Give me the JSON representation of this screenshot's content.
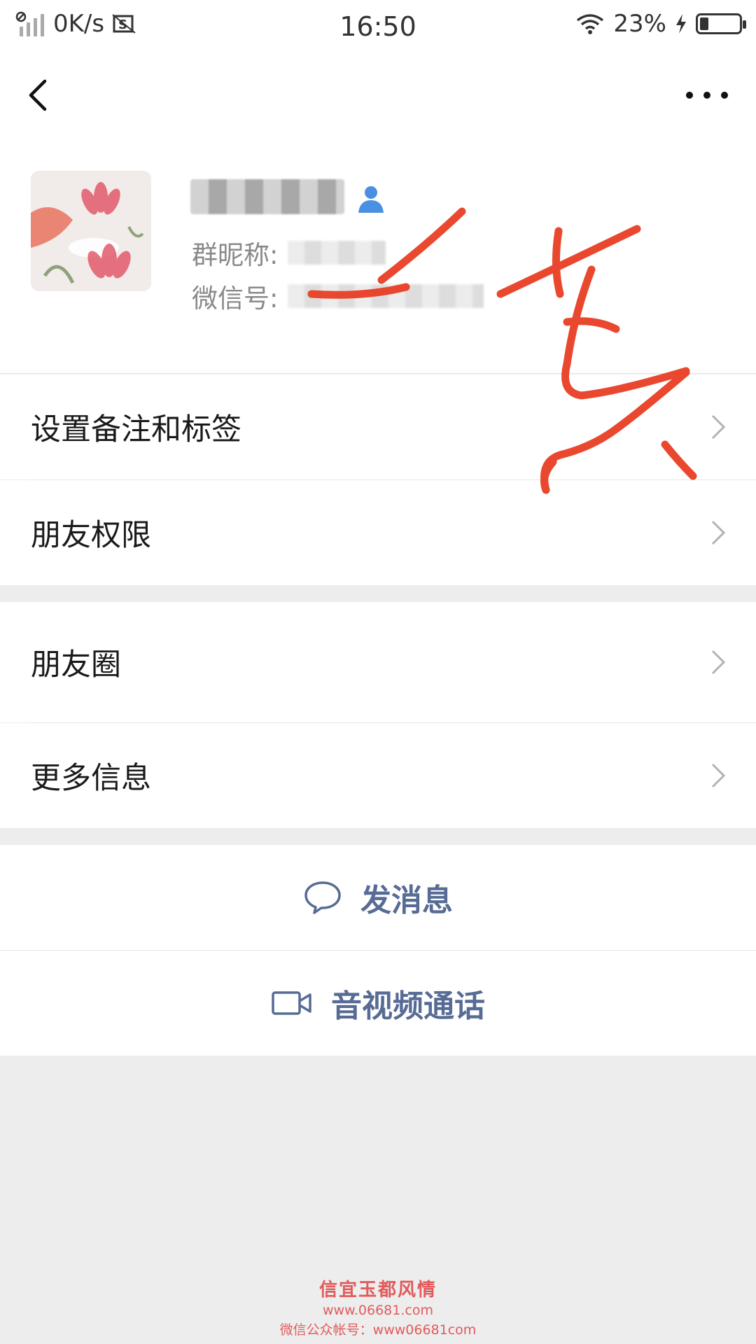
{
  "status_bar": {
    "speed": "0K/s",
    "time": "16:50",
    "battery_percent": "23%",
    "battery_level": 0.23
  },
  "nav": {
    "back_icon": "chevron-left-icon",
    "more_icon": "more-dots-icon"
  },
  "profile": {
    "group_nickname_label": "群昵称:",
    "wechat_id_label": "微信号:",
    "contact_icon": "person-icon"
  },
  "menu_section_1": [
    {
      "label": "设置备注和标签"
    },
    {
      "label": "朋友权限"
    }
  ],
  "menu_section_2": [
    {
      "label": "朋友圈"
    },
    {
      "label": "更多信息"
    }
  ],
  "actions": {
    "send_message": "发消息",
    "video_call": "音视频通话"
  },
  "colors": {
    "link": "#576b95",
    "background": "#ededed",
    "ink": "#e8391e"
  },
  "watermark": {
    "title": "信宜玉都风情",
    "url": "www.06681.com",
    "subtitle": "微信公众帐号：www06681com"
  }
}
